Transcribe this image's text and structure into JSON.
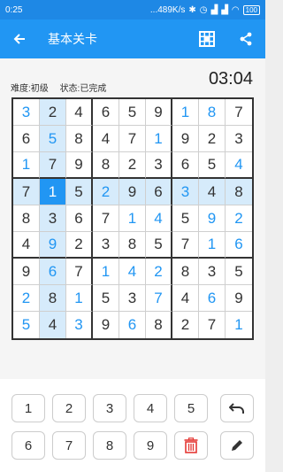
{
  "status_bar": {
    "time": "0:25",
    "network_speed": "...489K/s",
    "battery": "100"
  },
  "app_bar": {
    "title": "基本关卡",
    "back_icon": "arrow-back-icon",
    "grid_icon": "grid-icon",
    "share_icon": "share-icon"
  },
  "info": {
    "difficulty": "难度:初级",
    "status": "状态:已完成",
    "timer": "03:04"
  },
  "board": {
    "rows": [
      [
        "3",
        "2",
        "4",
        "6",
        "5",
        "9",
        "1",
        "8",
        "7"
      ],
      [
        "6",
        "5",
        "8",
        "4",
        "7",
        "1",
        "9",
        "2",
        "3"
      ],
      [
        "1",
        "7",
        "9",
        "8",
        "2",
        "3",
        "6",
        "5",
        "4"
      ],
      [
        "7",
        "1",
        "5",
        "2",
        "9",
        "6",
        "3",
        "4",
        "8"
      ],
      [
        "8",
        "3",
        "6",
        "7",
        "1",
        "4",
        "5",
        "9",
        "2"
      ],
      [
        "4",
        "9",
        "2",
        "3",
        "8",
        "5",
        "7",
        "1",
        "6"
      ],
      [
        "9",
        "6",
        "7",
        "1",
        "4",
        "2",
        "8",
        "3",
        "5"
      ],
      [
        "2",
        "8",
        "1",
        "5",
        "3",
        "7",
        "4",
        "6",
        "9"
      ],
      [
        "5",
        "4",
        "3",
        "9",
        "6",
        "8",
        "2",
        "7",
        "1"
      ]
    ],
    "user_entered": [
      [
        1,
        0,
        0,
        0,
        0,
        0,
        1,
        1,
        0
      ],
      [
        0,
        1,
        0,
        0,
        0,
        1,
        0,
        0,
        0
      ],
      [
        1,
        0,
        0,
        0,
        0,
        0,
        0,
        0,
        1
      ],
      [
        0,
        0,
        0,
        1,
        0,
        0,
        1,
        0,
        0
      ],
      [
        0,
        0,
        0,
        0,
        1,
        1,
        0,
        1,
        1
      ],
      [
        0,
        1,
        0,
        0,
        0,
        0,
        0,
        1,
        1
      ],
      [
        0,
        1,
        0,
        1,
        1,
        1,
        0,
        0,
        0
      ],
      [
        1,
        0,
        1,
        0,
        0,
        1,
        0,
        1,
        0
      ],
      [
        1,
        0,
        1,
        0,
        1,
        0,
        0,
        0,
        1
      ]
    ],
    "selected": {
      "row": 4,
      "col": 2
    }
  },
  "keypad": {
    "row1": [
      "1",
      "2",
      "3",
      "4",
      "5"
    ],
    "row2": [
      "6",
      "7",
      "8",
      "9"
    ],
    "undo_icon": "undo-icon",
    "delete_icon": "trash-icon",
    "pencil_icon": "pencil-icon",
    "delete_color": "#e53935"
  }
}
